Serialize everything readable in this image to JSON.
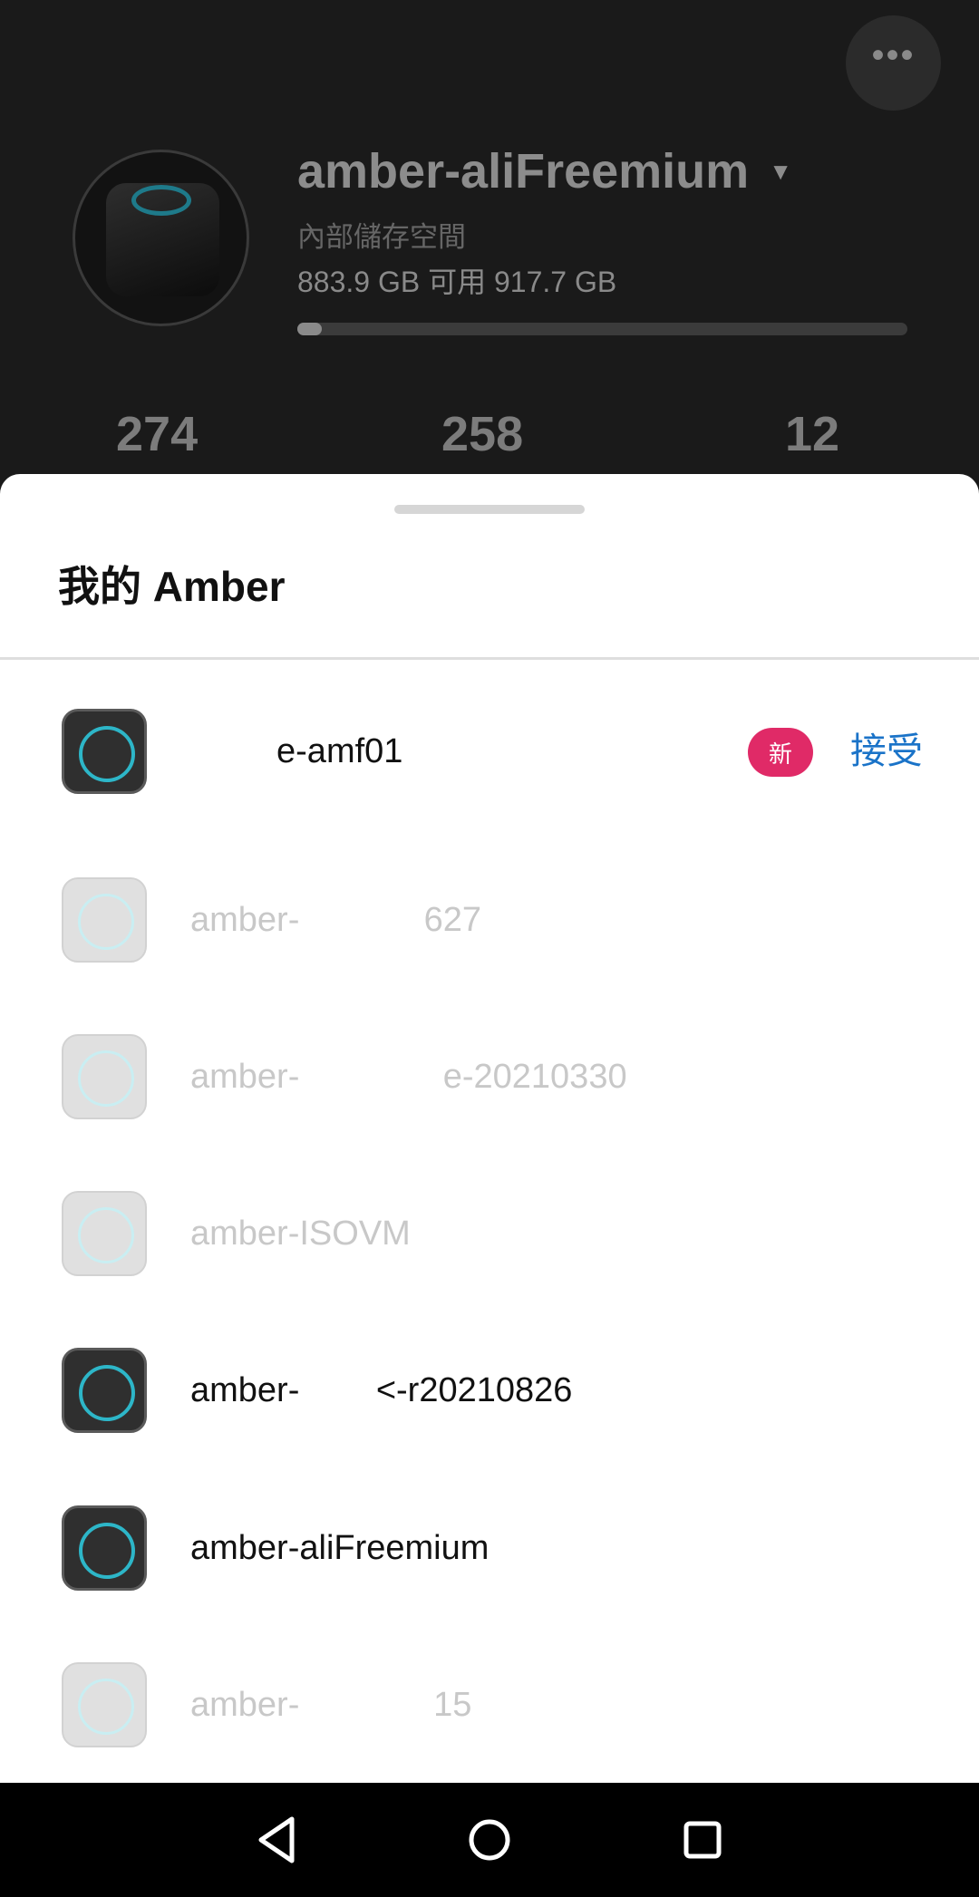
{
  "header": {
    "more_icon": "more-horizontal-icon",
    "device_name": "amber-aliFreemium",
    "storage_label": "內部儲存空間",
    "storage_value": "883.9 GB 可用 917.7 GB",
    "usage_fraction": 0.04
  },
  "stats": [
    "274",
    "258",
    "12"
  ],
  "sheet": {
    "title": "我的 Amber",
    "devices": [
      {
        "name": "         e-amf01",
        "state": "active",
        "badge": "新",
        "action": "接受"
      },
      {
        "name": "amber-             627",
        "state": "dim"
      },
      {
        "name": "amber-               e-20210330",
        "state": "dim"
      },
      {
        "name": "amber-ISOVM",
        "state": "dim"
      },
      {
        "name": "amber-        <-r20210826",
        "state": "active"
      },
      {
        "name": "amber-aliFreemium",
        "state": "active"
      },
      {
        "name": "amber-              15",
        "state": "dim"
      }
    ]
  },
  "navbar": {
    "back_icon": "back-triangle-icon",
    "home_icon": "home-circle-icon",
    "recents_icon": "recents-square-icon"
  },
  "colors": {
    "accent_blue": "#1a73c8",
    "badge_pink": "#e02a67",
    "ring_teal": "#2db6c8"
  }
}
